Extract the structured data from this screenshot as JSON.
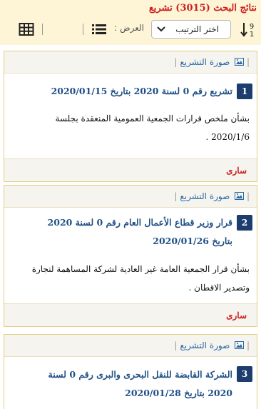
{
  "header": {
    "results_title": "نتائج البحث (3015) تشريع",
    "sort_icon": "sort-numeric-down-icon",
    "sort_select": {
      "selected": "اختر الترتيب"
    },
    "view_label": "العرض :",
    "list_view_icon": "list-view-icon",
    "grid_view_icon": "grid-view-icon"
  },
  "results": [
    {
      "number": "1",
      "image_link": "صورة التشريع",
      "title_line1": "تشريع رقم 0 لسنة 2020 بتاريخ 2020/01/15",
      "title_line2": "",
      "desc_line1": "بشأن ملخص قرارات الجمعية العمومية المنعقدة بجلسة",
      "desc_line2": "2020/1/6 .",
      "status": "سارى"
    },
    {
      "number": "2",
      "image_link": "صورة التشريع",
      "title_line1": "قرار وزير قطاع الأعمال العام رقم 0 لسنة 2020",
      "title_line2": "بتاريخ 2020/01/26",
      "desc_line1": "بشأن قرار الجمعية العامة غير العادية لشركة المساهمة لتجارة",
      "desc_line2": "وتصدير الاقطان .",
      "status": "سارى"
    },
    {
      "number": "3",
      "image_link": "صورة التشريع",
      "title_line1": "الشركة القابضة للنقل البحرى والبرى رقم 0 لسنة",
      "title_line2": "2020 بتاريخ 2020/01/28"
    }
  ],
  "colors": {
    "accent_red": "#cc1f1f",
    "title_blue": "#1f4f86",
    "badge_navy": "#1c3d6e",
    "panel_yellow": "#fdf5d6",
    "card_border": "#e3cf82"
  }
}
